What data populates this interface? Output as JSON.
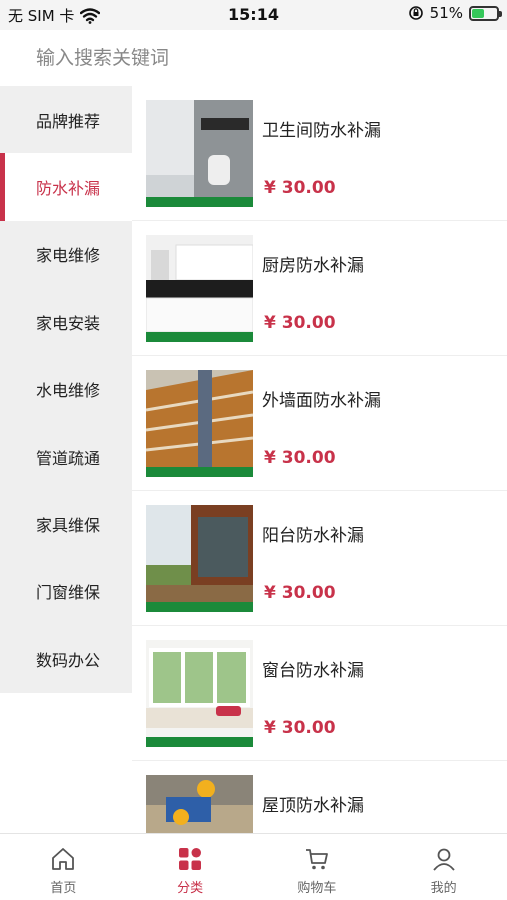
{
  "status_bar": {
    "carrier": "无 SIM 卡",
    "time": "15:14",
    "battery_percent": "51%",
    "battery_level": 0.51,
    "accent_color": "#34c759"
  },
  "search": {
    "placeholder": "输入搜索关键词"
  },
  "sidebar": {
    "items": [
      {
        "label": "品牌推荐"
      },
      {
        "label": "防水补漏"
      },
      {
        "label": "家电维修"
      },
      {
        "label": "家电安装"
      },
      {
        "label": "水电维修"
      },
      {
        "label": "管道疏通"
      },
      {
        "label": "家具维保"
      },
      {
        "label": "门窗维保"
      },
      {
        "label": "数码办公"
      }
    ],
    "active_index": 1,
    "active_color": "#c8324a"
  },
  "products": [
    {
      "name": "卫生间防水补漏",
      "price": "¥ 30.00",
      "image_icon": "bathroom-photo"
    },
    {
      "name": "厨房防水补漏",
      "price": "¥ 30.00",
      "image_icon": "kitchen-photo"
    },
    {
      "name": "外墙面防水补漏",
      "price": "¥ 30.00",
      "image_icon": "exterior-wall-photo"
    },
    {
      "name": "阳台防水补漏",
      "price": "¥ 30.00",
      "image_icon": "balcony-photo"
    },
    {
      "name": "窗台防水补漏",
      "price": "¥ 30.00",
      "image_icon": "windowsill-photo"
    },
    {
      "name": "屋顶防水补漏",
      "price": "",
      "image_icon": "roof-photo"
    }
  ],
  "tab_bar": {
    "tabs": [
      {
        "label": "首页",
        "icon": "home-icon"
      },
      {
        "label": "分类",
        "icon": "category-icon"
      },
      {
        "label": "购物车",
        "icon": "cart-icon"
      },
      {
        "label": "我的",
        "icon": "profile-icon"
      }
    ],
    "active_index": 1
  }
}
